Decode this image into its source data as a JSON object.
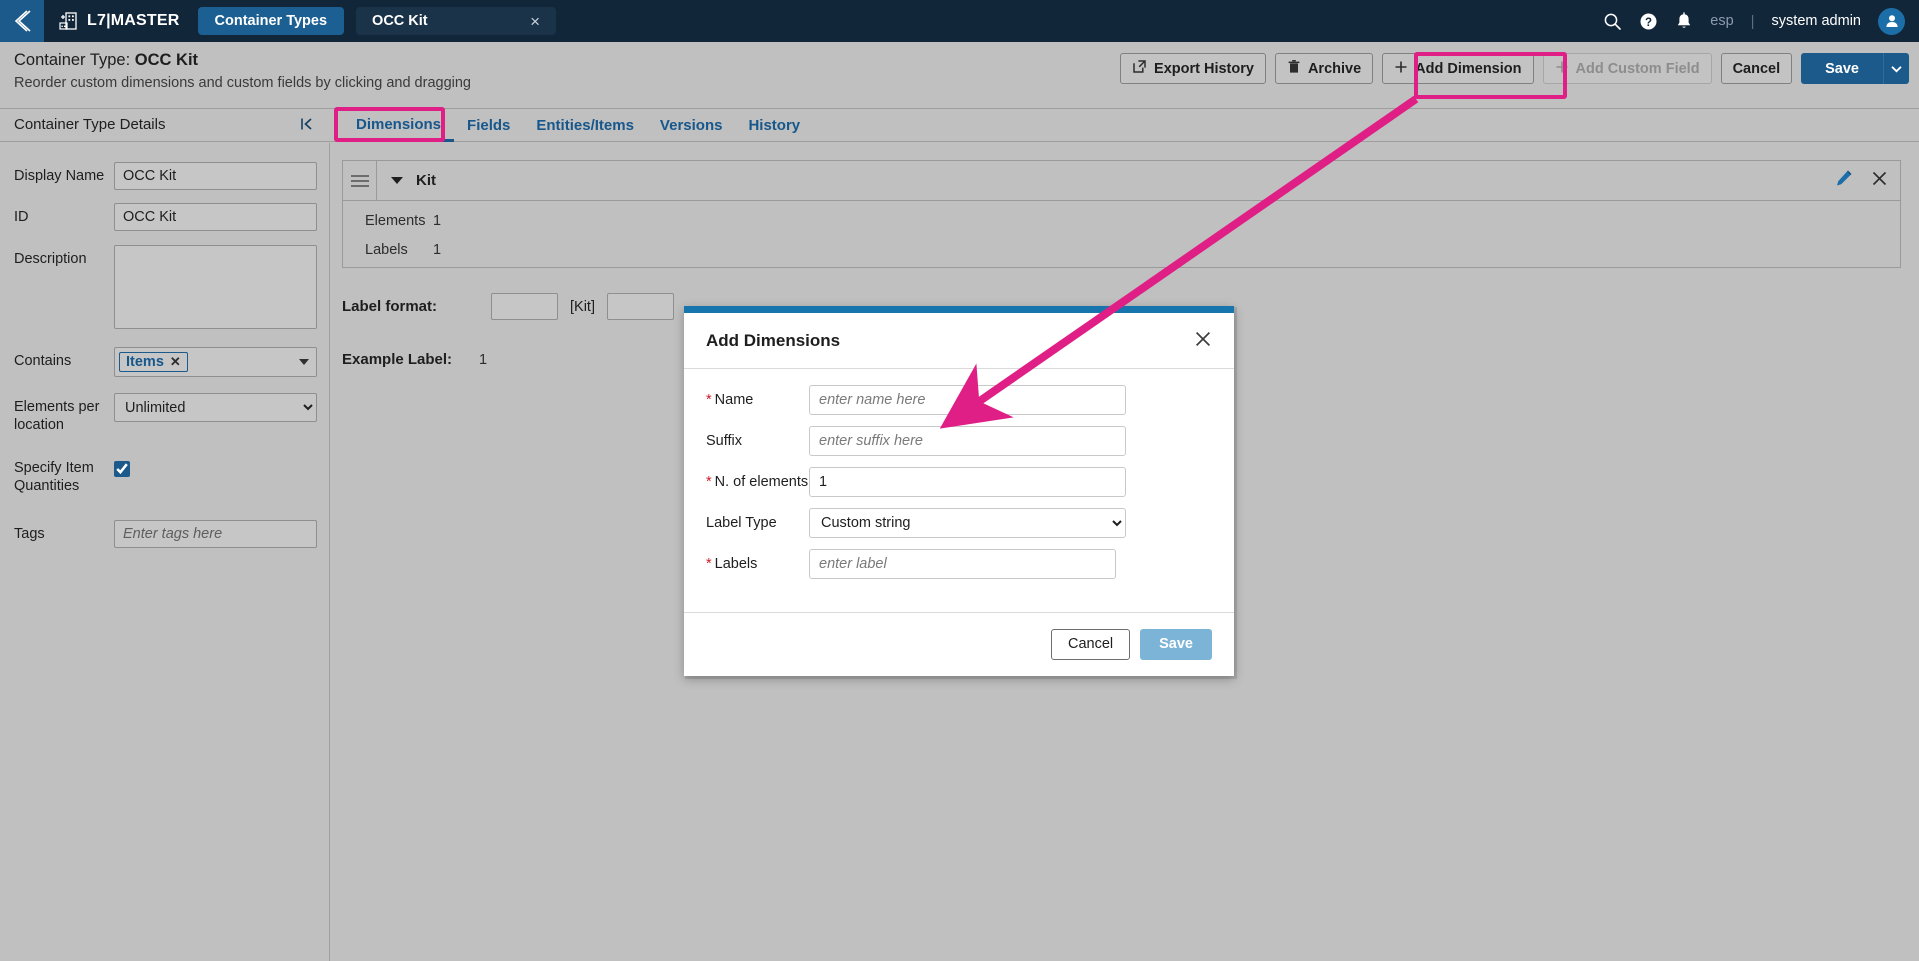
{
  "topbar": {
    "back_icon": "back-chevron-icon",
    "brand_icon": "add-building-icon",
    "brand": "L7|MASTER",
    "tab_container_types": "Container Types",
    "tab_document": "OCC Kit",
    "tab_document_close": "×",
    "search_icon": "search-icon",
    "help_icon": "help-circle-icon",
    "bell_icon": "bell-icon",
    "language": "esp",
    "divider": "|",
    "username": "system admin",
    "avatar_icon": "user-avatar-icon"
  },
  "page_header": {
    "title_prefix": "Container Type: ",
    "title_value": "OCC Kit",
    "subtitle": "Reorder custom dimensions and custom fields by clicking and dragging",
    "buttons": {
      "export_history": "Export History",
      "archive": "Archive",
      "add_dimension": "Add Dimension",
      "add_custom_field": "Add Custom Field",
      "cancel": "Cancel",
      "save": "Save"
    },
    "icons": {
      "export": "external-link-icon",
      "archive": "trash-icon",
      "plus": "plus-icon",
      "save_caret": "chevron-down-icon"
    }
  },
  "subbar": {
    "details_label": "Container Type Details",
    "collapse_icon": "collapse-panel-icon",
    "tabs": [
      {
        "label": "Dimensions",
        "active": true
      },
      {
        "label": "Fields",
        "active": false
      },
      {
        "label": "Entities/Items",
        "active": false
      },
      {
        "label": "Versions",
        "active": false
      },
      {
        "label": "History",
        "active": false
      }
    ]
  },
  "left_panel": {
    "display_name": {
      "label": "Display Name",
      "value": "OCC Kit"
    },
    "id": {
      "label": "ID",
      "value": "OCC Kit"
    },
    "description": {
      "label": "Description",
      "value": ""
    },
    "contains": {
      "label": "Contains",
      "token": "Items",
      "token_remove": "✕"
    },
    "elements_per_location": {
      "label": "Elements per location",
      "value": "Unlimited",
      "options": [
        "Unlimited"
      ]
    },
    "specify_item_quantities": {
      "label": "Specify Item Quantities",
      "checked": true
    },
    "tags": {
      "label": "Tags",
      "value": "",
      "placeholder": "Enter tags here"
    }
  },
  "main": {
    "dimension_card": {
      "drag_handle_icon": "drag-handle-icon",
      "collapse_icon": "caret-down-icon",
      "title": "Kit",
      "edit_icon": "pencil-icon",
      "remove_icon": "close-icon",
      "rows": [
        {
          "key": "Elements",
          "value": "1"
        },
        {
          "key": "Labels",
          "value": "1"
        }
      ]
    },
    "label_format": {
      "label": "Label format:",
      "prefix_value": "",
      "token": "[Kit]",
      "suffix_value": ""
    },
    "example_label": {
      "label": "Example Label:",
      "value": "1"
    }
  },
  "modal": {
    "title": "Add Dimensions",
    "close_icon": "close-icon",
    "fields": [
      {
        "label": "Name",
        "required": true,
        "type": "text",
        "value": "",
        "placeholder": "enter name here"
      },
      {
        "label": "Suffix",
        "required": false,
        "type": "text",
        "value": "",
        "placeholder": "enter suffix here"
      },
      {
        "label": "N. of elements",
        "required": true,
        "type": "text",
        "value": "1",
        "placeholder": ""
      },
      {
        "label": "Label Type",
        "required": false,
        "type": "select",
        "value": "Custom string",
        "options": [
          "Custom string"
        ]
      },
      {
        "label": "Labels",
        "required": true,
        "type": "text",
        "value": "",
        "placeholder": "enter label"
      }
    ],
    "cancel": "Cancel",
    "save": "Save"
  },
  "annotations": {
    "highlight_color": "#e01f86",
    "arrow_from": "add-dimension-button",
    "arrow_to": "modal-name-input"
  },
  "colors": {
    "nav_bg": "#12263a",
    "accent_blue": "#1b5a8a",
    "page_bg": "#c0c0c0",
    "highlight_pink": "#e01f86",
    "modal_stripe": "#1675ad",
    "required_red": "#d11a2a"
  }
}
